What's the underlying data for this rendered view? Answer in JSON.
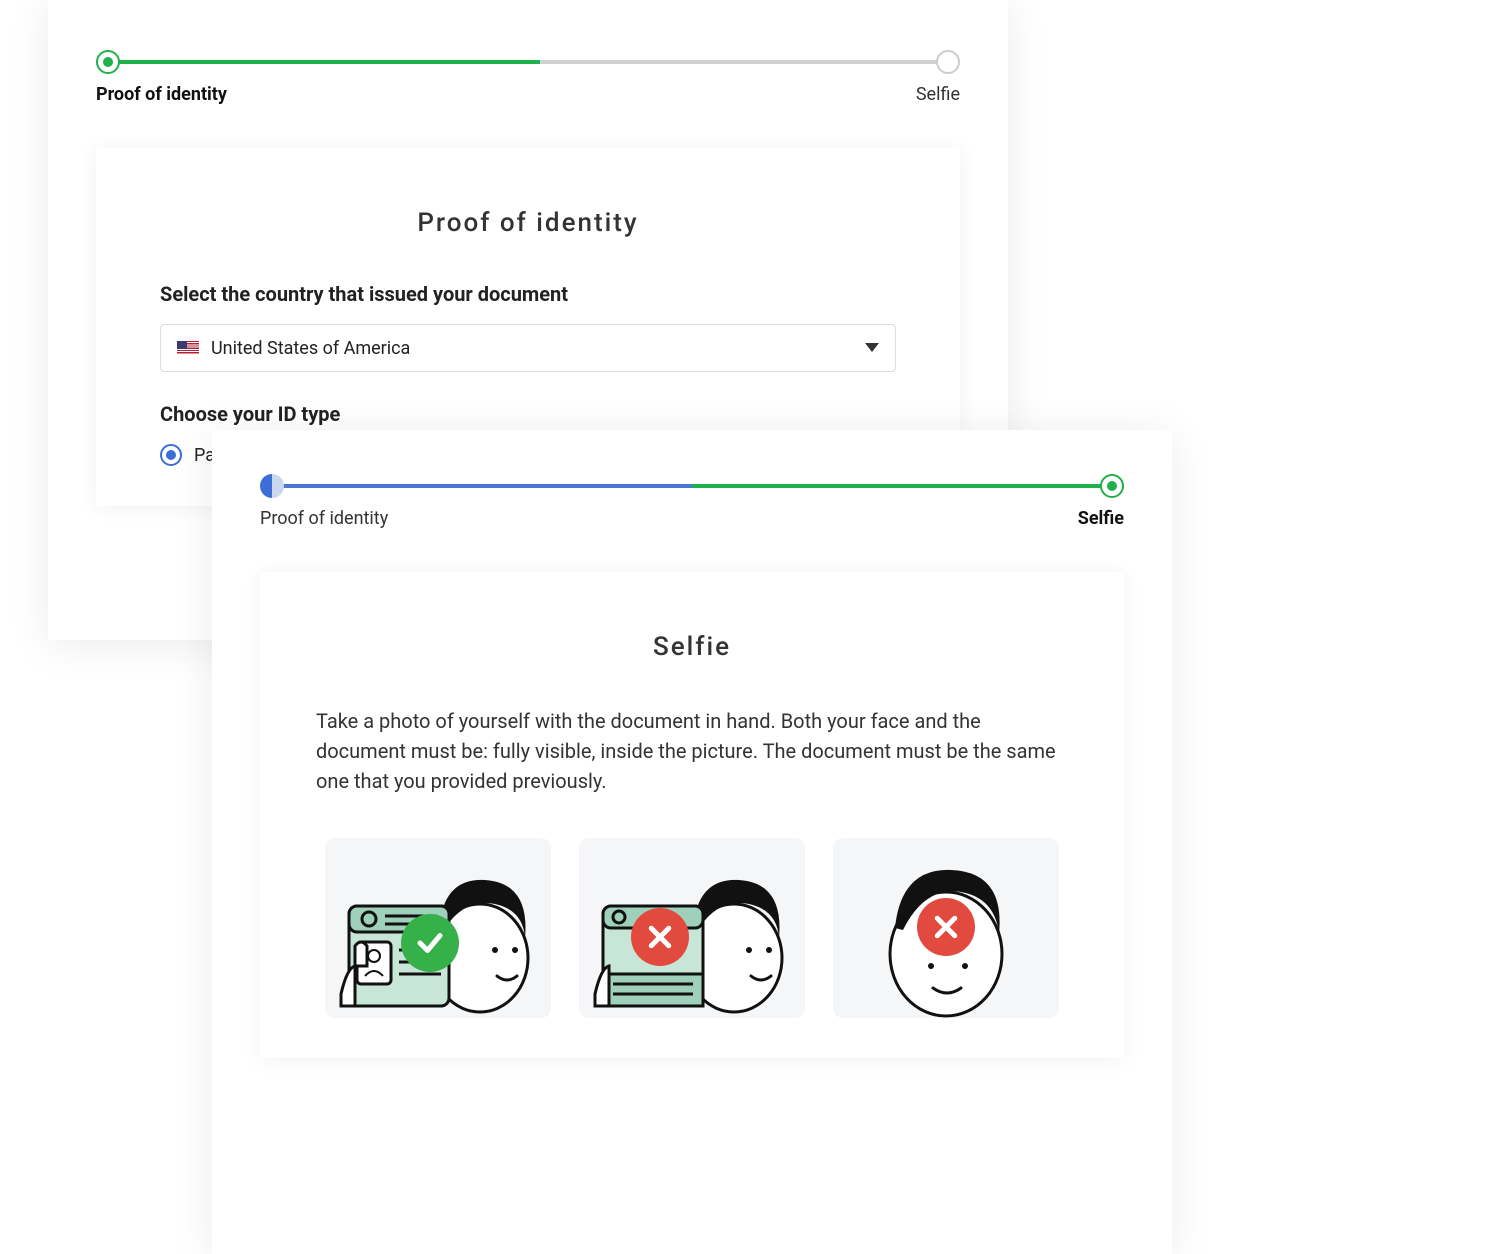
{
  "stepper": {
    "step1_label": "Proof of identity",
    "step2_label": "Selfie"
  },
  "proof_identity_card": {
    "title": "Proof of identity",
    "country_label": "Select the country that issued your document",
    "selected_country": "United States of America",
    "id_type_label": "Choose your ID type",
    "radio_passport": "Passport"
  },
  "selfie_card": {
    "title": "Selfie",
    "instruction": "Take a photo of yourself with the document in hand. Both your face and the document must be: fully visible, inside the picture. The document must be the same one that you provided previously.",
    "examples": [
      {
        "status": "good"
      },
      {
        "status": "bad_doc"
      },
      {
        "status": "bad_nodoc"
      }
    ]
  },
  "colors": {
    "green": "#20b24a",
    "blue": "#3b6fd6",
    "red": "#e24a3f"
  }
}
